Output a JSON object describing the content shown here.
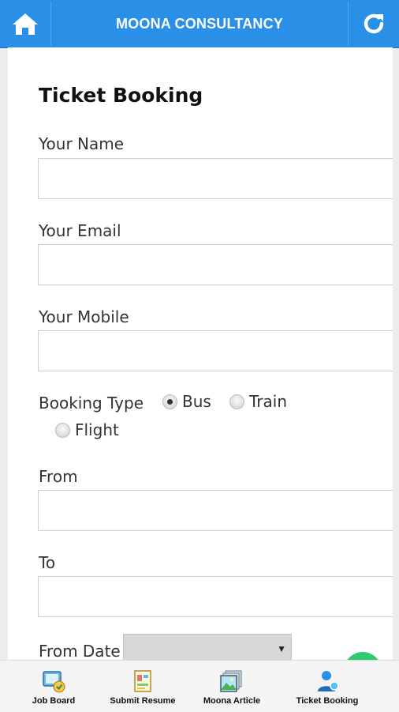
{
  "header": {
    "title": "MOONA CONSULTANCY",
    "home_icon": "home-icon",
    "refresh_icon": "refresh-icon",
    "color": "#2a8fe6"
  },
  "form": {
    "heading": "Ticket Booking",
    "name_label": "Your Name",
    "name_value": "",
    "email_label": "Your Email",
    "email_value": "",
    "mobile_label": "Your Mobile",
    "mobile_value": "",
    "booking_type_label": "Booking Type",
    "booking_options": [
      {
        "label": "Bus",
        "checked": true
      },
      {
        "label": "Train",
        "checked": false
      },
      {
        "label": "Flight",
        "checked": false
      }
    ],
    "from_label": "From",
    "from_value": "",
    "to_label": "To",
    "to_value": "",
    "from_date_label": "From Date",
    "from_date_value": ""
  },
  "bottom_nav": {
    "items": [
      {
        "label": "Job Board",
        "icon": "job-board-icon"
      },
      {
        "label": "Submit Resume",
        "icon": "submit-resume-icon"
      },
      {
        "label": "Moona Article",
        "icon": "moona-article-icon"
      },
      {
        "label": "Ticket Booking",
        "icon": "ticket-booking-icon"
      }
    ]
  }
}
